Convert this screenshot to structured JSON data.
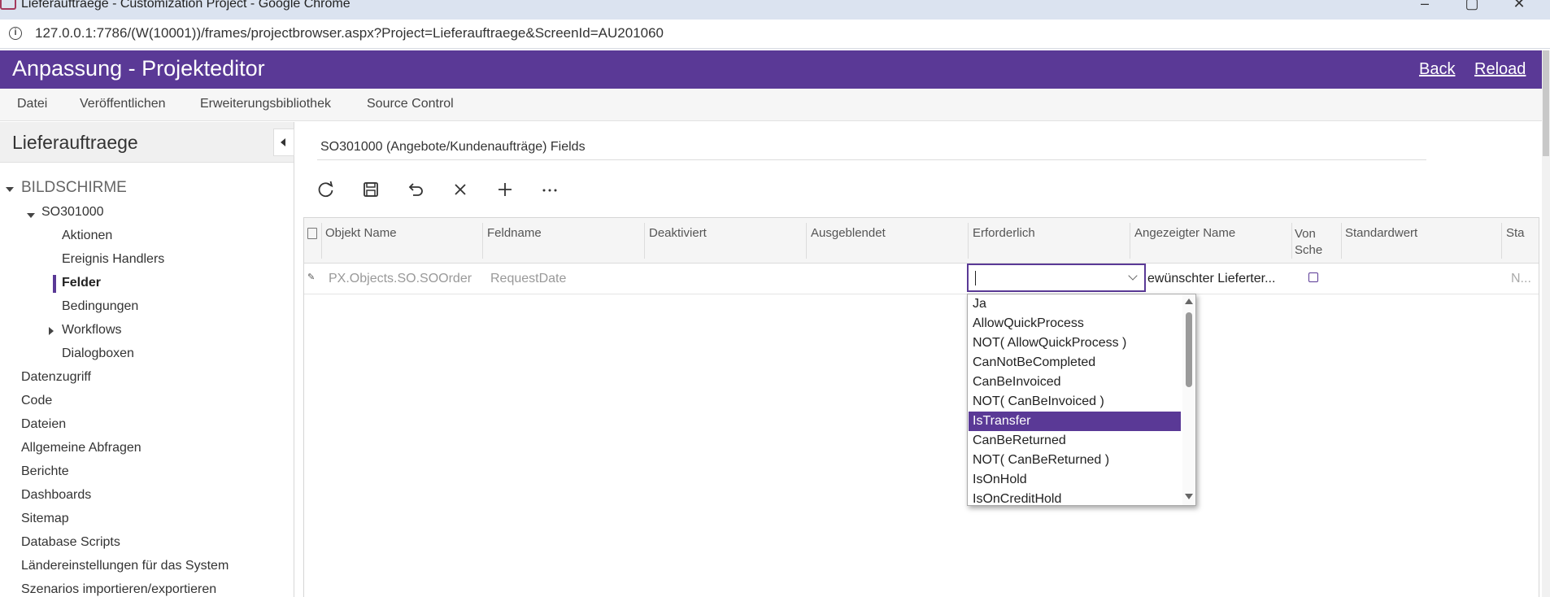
{
  "browser": {
    "window_title": "Lieferauftraege - Customization Project - Google Chrome",
    "url": "127.0.0.1:7786/(W(10001))/frames/projectbrowser.aspx?Project=Lieferauftraege&ScreenId=AU201060"
  },
  "header": {
    "title": "Anpassung - Projekteditor",
    "back_label": "Back",
    "reload_label": "Reload"
  },
  "menu": {
    "items": [
      "Datei",
      "Veröffentlichen",
      "Erweiterungsbibliothek",
      "Source Control"
    ]
  },
  "sidebar": {
    "title": "Lieferauftraege",
    "tree": {
      "root": "BILDSCHIRME",
      "screen": "SO301000",
      "children": [
        "Aktionen",
        "Ereignis Handlers",
        "Felder",
        "Bedingungen",
        "Workflows",
        "Dialogboxen"
      ],
      "active_child": "Felder",
      "sections": [
        "Datenzugriff",
        "Code",
        "Dateien",
        "Allgemeine Abfragen",
        "Berichte",
        "Dashboards",
        "Sitemap",
        "Database Scripts",
        "Ländereinstellungen für das System",
        "Szenarios importieren/exportieren"
      ]
    }
  },
  "main": {
    "title": "SO301000 (Angebote/Kundenaufträge) Fields",
    "toolbar_icons": [
      "refresh-icon",
      "save-icon",
      "undo-icon",
      "close-icon",
      "add-icon",
      "more-icon"
    ],
    "grid": {
      "columns": [
        "Objekt Name",
        "Feldname",
        "Deaktiviert",
        "Ausgeblendet",
        "Erforderlich",
        "Angezeigter Name",
        "Von Sche",
        "Standardwert",
        "Sta"
      ],
      "row": {
        "objekt_name": "PX.Objects.SO.SOOrder",
        "feldname": "RequestDate",
        "erforderlich": "",
        "angezeigter_name": "ewünschter Lieferter...",
        "von_schema_checked": false,
        "last_cell": "N..."
      }
    },
    "dropdown": {
      "options": [
        "Ja",
        "AllowQuickProcess",
        "NOT( AllowQuickProcess )",
        "CanNotBeCompleted",
        "CanBeInvoiced",
        "NOT( CanBeInvoiced )",
        "IsTransfer",
        "CanBeReturned",
        "NOT( CanBeReturned )",
        "IsOnHold",
        "IsOnCreditHold"
      ],
      "highlighted": "IsTransfer"
    }
  },
  "colors": {
    "accent": "#5a3996",
    "chrome_titlebar": "#dbe3f0"
  }
}
